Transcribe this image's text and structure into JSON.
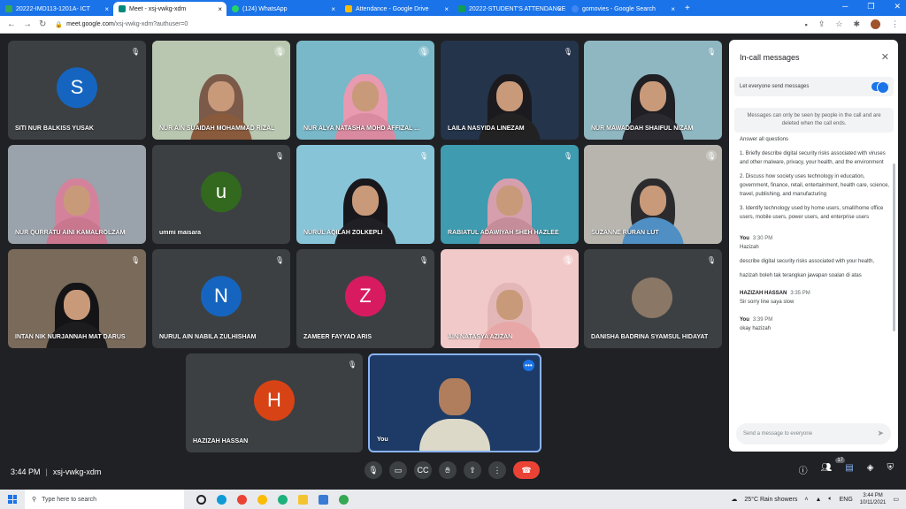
{
  "browser": {
    "tabs": [
      {
        "label": "20222-IMD113-1201A- ICT",
        "color": "#34a853",
        "active": false
      },
      {
        "label": "Meet - xsj-vwkg-xdm",
        "color": "#00897b",
        "active": true
      },
      {
        "label": "(124) WhatsApp",
        "color": "#25d366",
        "active": false
      },
      {
        "label": "Attendance - Google Drive",
        "color": "#fbbc04",
        "active": false
      },
      {
        "label": "20222-STUDENT'S ATTENDANCE",
        "color": "#0f9d58",
        "active": false
      },
      {
        "label": "gomovies - Google Search",
        "color": "#4285f4",
        "active": false
      }
    ],
    "url_host": "meet.google.com",
    "url_path": "/xsj-vwkg-xdm?authuser=0"
  },
  "participants": [
    {
      "name": "SITI NUR BALKISS YUSAK",
      "letter": "S",
      "avatar_color": "#1565c0"
    },
    {
      "name": "NUR AIN SUAIDAH MOHAMMAD RIZAL"
    },
    {
      "name": "NUR ALYA NATASHA MOHD AFFIZAL ..."
    },
    {
      "name": "LAILA NASYIDA LINEZAM"
    },
    {
      "name": "NUR MAWADDAH SHAIFUL NIZAM"
    },
    {
      "name": "NUR QURRATU AINI KAMALROLZAM"
    },
    {
      "name": "ummi maisara",
      "letter": "u",
      "avatar_color": "#33691e"
    },
    {
      "name": "NURUL AQILAH ZOLKEPLI"
    },
    {
      "name": "RABIATUL ADAWIYAH SHEH HAZLEE"
    },
    {
      "name": "SUZANNE RURAN LUT"
    },
    {
      "name": "INTAN NIK NURJANNAH MAT DARUS"
    },
    {
      "name": "NURUL AIN NABILA ZULHISHAM",
      "letter": "N",
      "avatar_color": "#1565c0"
    },
    {
      "name": "ZAMEER FAYYAD ARIS",
      "letter": "Z",
      "avatar_color": "#d81b60"
    },
    {
      "name": "AIN NATASYA AZIZAN"
    },
    {
      "name": "DANISHA BADRINA SYAMSUL HIDAYAT"
    },
    {
      "name": "HAZIZAH HASSAN",
      "letter": "H",
      "avatar_color": "#d84315"
    },
    {
      "name": "You"
    }
  ],
  "meeting": {
    "time": "3:44 PM",
    "separator": "|",
    "code": "xsj-vwkg-xdm",
    "people_count": "17"
  },
  "chat": {
    "title": "In-call messages",
    "toggle_label": "Let everyone send messages",
    "notice": "Messages can only be seen by people in the call and are deleted when the call ends.",
    "intro": "Answer all questions",
    "q1": "1. Briefly describe digital security risks associated with viruses and other malware, privacy, your health, and the environment",
    "q2": "2. Discuss how society uses technology in education, government, finance, retail, entertainment, health care, science, travel, publishing, and manufacturing",
    "q3": "3. Identify technology used by home users, small/home office users, mobile users, power users, and enterprise users",
    "messages": [
      {
        "sender": "You",
        "time": "3:30 PM",
        "lines": [
          "Hazizah",
          "describe digital security risks associated with your health,",
          "hazizah boleh tak terangkan jawapan soalan di atas"
        ]
      },
      {
        "sender": "HAZIZAH HASSAN",
        "time": "3:35 PM",
        "lines": [
          "Sir sorry line saya slow"
        ]
      },
      {
        "sender": "You",
        "time": "3:39 PM",
        "lines": [
          "okay hazizah"
        ]
      }
    ],
    "input_placeholder": "Send a message to everyone"
  },
  "taskbar": {
    "search_placeholder": "Type here to search",
    "weather": "25°C  Rain showers",
    "lang": "ENG",
    "time": "3:44 PM",
    "date": "10/11/2021"
  }
}
